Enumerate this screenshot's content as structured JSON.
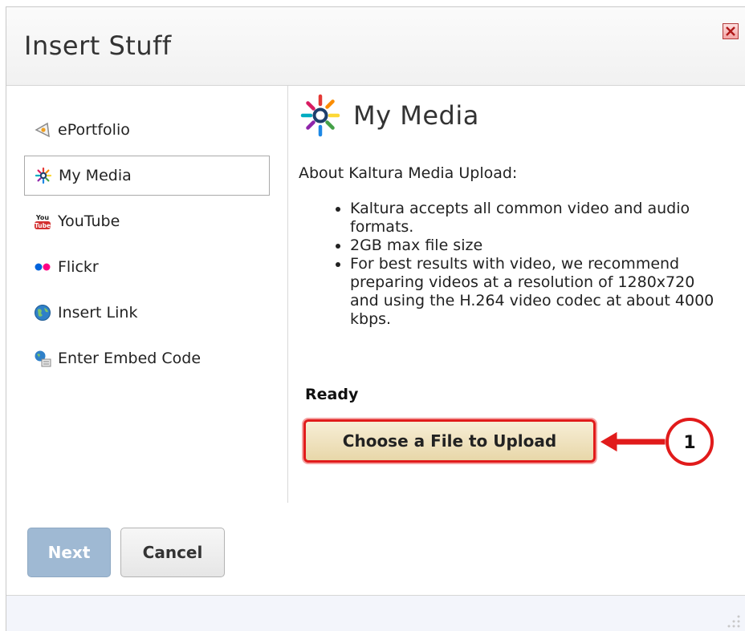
{
  "dialog": {
    "title": "Insert Stuff",
    "close_icon": "close-icon"
  },
  "sidebar": {
    "items": [
      {
        "label": "ePortfolio",
        "icon": "eportfolio-icon",
        "selected": false
      },
      {
        "label": "My Media",
        "icon": "kaltura-icon",
        "selected": true
      },
      {
        "label": "YouTube",
        "icon": "youtube-icon",
        "selected": false
      },
      {
        "label": "Flickr",
        "icon": "flickr-icon",
        "selected": false
      },
      {
        "label": "Insert Link",
        "icon": "globe-icon",
        "selected": false
      },
      {
        "label": "Enter Embed Code",
        "icon": "embed-icon",
        "selected": false
      }
    ]
  },
  "content": {
    "heading": "My Media",
    "about": "About Kaltura Media Upload:",
    "bullets": [
      "Kaltura accepts all common video and audio formats.",
      "2GB max file size",
      "For best results with video, we recommend preparing videos at a resolution of 1280x720 and using the H.264 video codec at about 4000 kbps."
    ],
    "status": "Ready",
    "upload_label": "Choose a File to Upload",
    "callout_number": "1"
  },
  "footer": {
    "next_label": "Next",
    "cancel_label": "Cancel"
  },
  "colors": {
    "callout_red": "#e11b1b",
    "next_disabled": "#9fb9d3"
  }
}
